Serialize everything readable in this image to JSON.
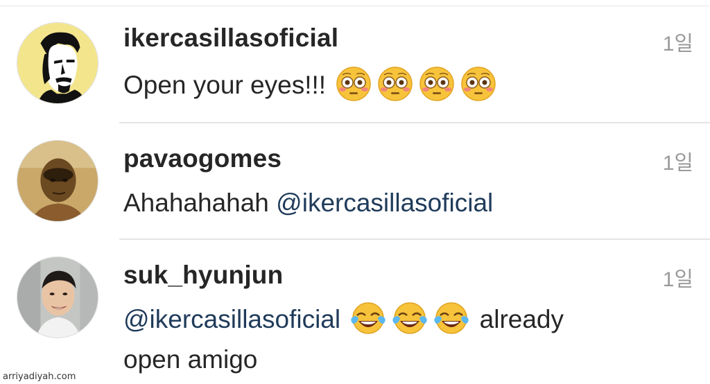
{
  "comments": [
    {
      "username": "ikercasillasoficial",
      "timestamp": "1일",
      "text": "Open your eyes!!!",
      "emojis": [
        "flushed-face-emoji",
        "flushed-face-emoji",
        "flushed-face-emoji",
        "flushed-face-emoji"
      ]
    },
    {
      "username": "pavaogomes",
      "timestamp": "1일",
      "text": "Ahahahahah",
      "mention": "@ikercasillasoficial"
    },
    {
      "username": "suk_hyunjun",
      "timestamp": "1일",
      "mention": "@ikercasillasoficial",
      "emojis": [
        "tears-of-joy-emoji",
        "tears-of-joy-emoji",
        "tears-of-joy-emoji"
      ],
      "text_line1_end": "already",
      "text_line2": "open amigo"
    }
  ],
  "watermark": "arriyadiyah.com",
  "colors": {
    "username": "#262626",
    "timestamp": "#9a9a9a",
    "mention": "#1f3b5a",
    "divider": "#e4e4e4"
  }
}
